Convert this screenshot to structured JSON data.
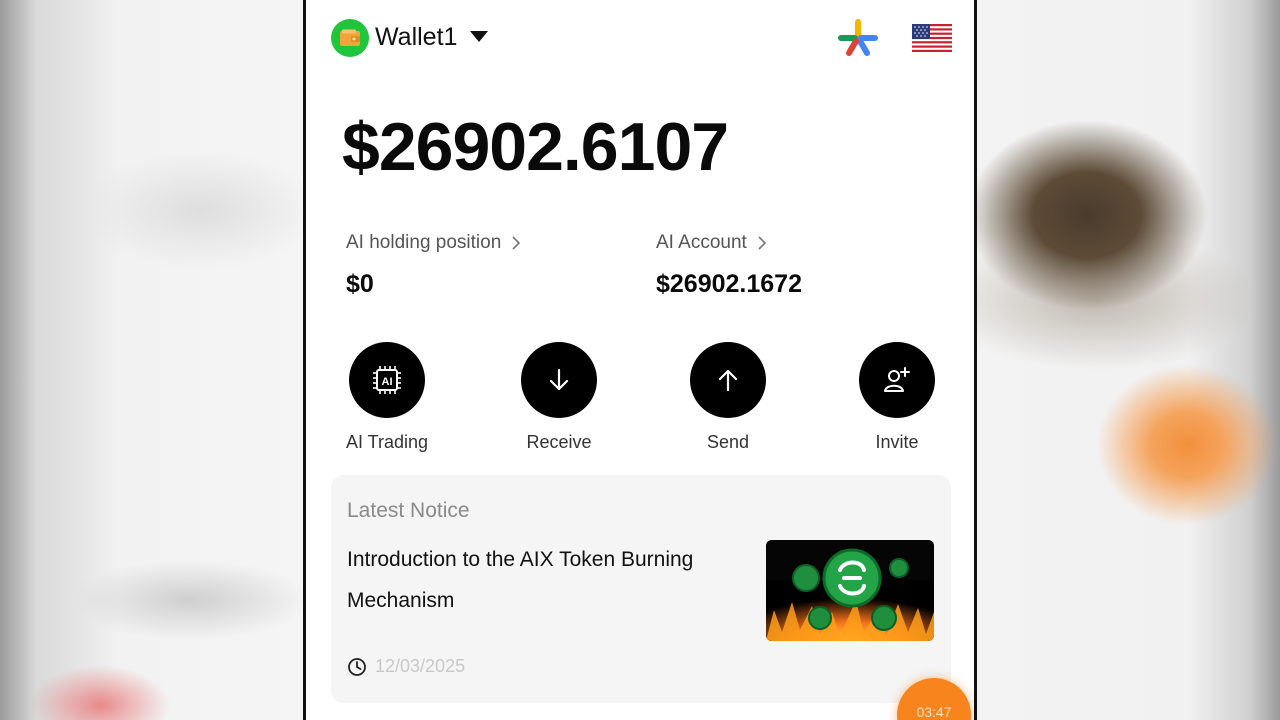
{
  "header": {
    "wallet_name": "Wallet1",
    "wallet_icon": "wallet-icon",
    "language_icon": "us-flag-icon"
  },
  "balance": "$26902.6107",
  "stats": [
    {
      "label": "AI holding position",
      "value": "$0"
    },
    {
      "label": "AI Account",
      "value": "$26902.1672"
    }
  ],
  "actions": [
    {
      "label": "AI Trading",
      "icon": "ai-chip-icon"
    },
    {
      "label": "Receive",
      "icon": "arrow-down-icon"
    },
    {
      "label": "Send",
      "icon": "arrow-up-icon"
    },
    {
      "label": "Invite",
      "icon": "add-user-icon"
    }
  ],
  "notice": {
    "title": "Latest Notice",
    "text": "Introduction to the AIX Token Burning Mechanism",
    "date": "12/03/2025"
  },
  "timer": "03:47",
  "colors": {
    "accent_green": "#1fc63b",
    "timer_orange": "#f7841d",
    "notice_bg": "#f5f5f5"
  }
}
